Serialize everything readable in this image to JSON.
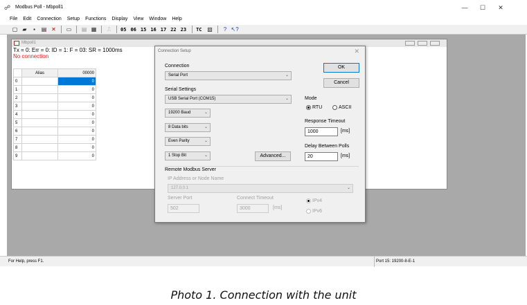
{
  "window": {
    "title": "Modbus Poll - Mbpoll1",
    "minimize": "—",
    "maximize": "☐",
    "close": "✕"
  },
  "menu": [
    "File",
    "Edit",
    "Connection",
    "Setup",
    "Functions",
    "Display",
    "View",
    "Window",
    "Help"
  ],
  "toolbar": {
    "codes": [
      "05",
      "06",
      "15",
      "16",
      "17",
      "22",
      "23"
    ],
    "tc": "TC"
  },
  "child": {
    "title": "Mbpoll1",
    "status_line": "Tx = 0: Err = 0: ID = 1: F = 03: SR = 1000ms",
    "connection_status": "No connection",
    "grid": {
      "header_alias": "Alias",
      "header_value": "00000",
      "rows": [
        {
          "n": "0",
          "v": "0"
        },
        {
          "n": "1",
          "v": "0"
        },
        {
          "n": "2",
          "v": "0"
        },
        {
          "n": "3",
          "v": "0"
        },
        {
          "n": "4",
          "v": "0"
        },
        {
          "n": "5",
          "v": "0"
        },
        {
          "n": "6",
          "v": "0"
        },
        {
          "n": "7",
          "v": "0"
        },
        {
          "n": "8",
          "v": "0"
        },
        {
          "n": "9",
          "v": "0"
        }
      ]
    }
  },
  "dialog": {
    "title": "Connection Setup",
    "connection_label": "Connection",
    "connection_value": "Serial Port",
    "serial_settings_label": "Serial Settings",
    "port_value": "USB Serial Port (COM15)",
    "baud_value": "19200 Baud",
    "databits_value": "8 Data bits",
    "parity_value": "Even Parity",
    "stopbit_value": "1 Stop Bit",
    "advanced_label": "Advanced...",
    "ok_label": "OK",
    "cancel_label": "Cancel",
    "mode_label": "Mode",
    "mode_rtu": "RTU",
    "mode_ascii": "ASCII",
    "response_timeout_label": "Response Timeout",
    "response_timeout_value": "1000",
    "ms_unit": "[ms]",
    "delay_label": "Delay Between Polls",
    "delay_value": "20",
    "remote_label": "Remote Modbus Server",
    "ip_label": "IP Address or Node Name",
    "ip_value": "127.0.0.1",
    "server_port_label": "Server Port",
    "server_port_value": "502",
    "connect_timeout_label": "Connect Timeout",
    "connect_timeout_value": "3000",
    "connect_timeout_unit": "[ms]",
    "ipv4": "IPv4",
    "ipv6": "IPv6"
  },
  "statusbar": {
    "help": "For Help, press F1.",
    "port": "Port 15: 19200-8-E-1"
  },
  "caption": "Photo 1. Connection with the unit"
}
